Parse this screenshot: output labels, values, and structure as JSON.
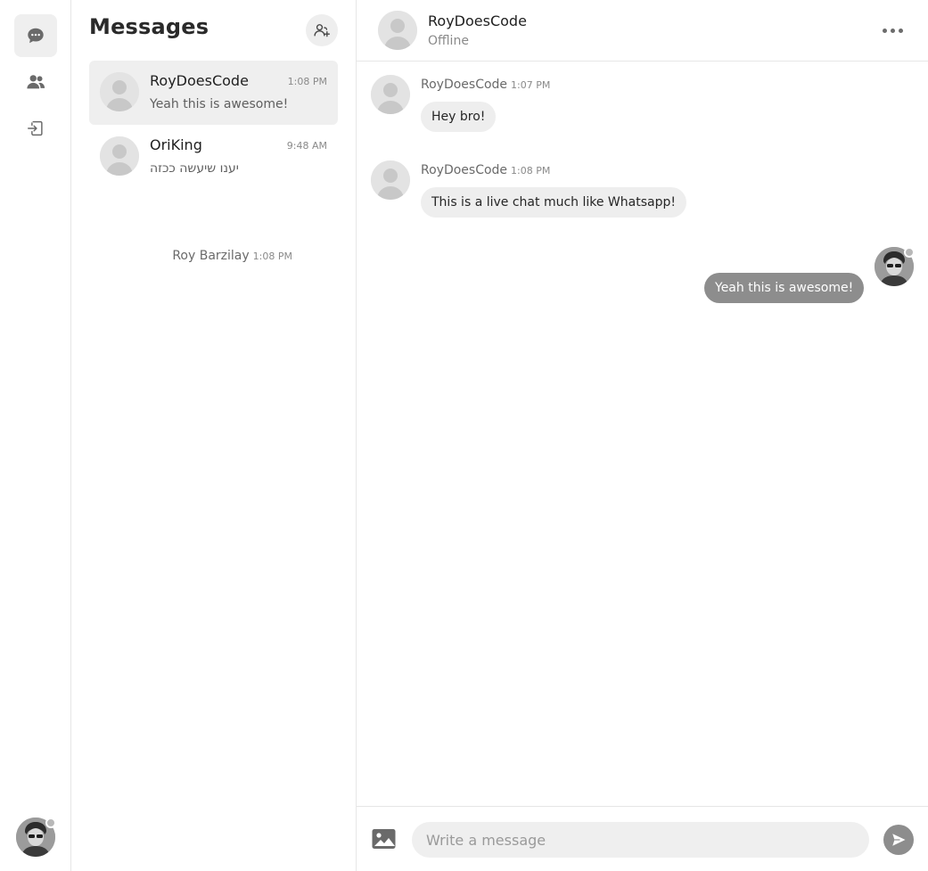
{
  "rail": {
    "items": [
      {
        "icon": "chat-bubble-icon",
        "active": true
      },
      {
        "icon": "users-icon",
        "active": false
      },
      {
        "icon": "logout-icon",
        "active": false
      }
    ],
    "me": {
      "presence": "offline"
    }
  },
  "list": {
    "title": "Messages",
    "conversations": [
      {
        "name": "RoyDoesCode",
        "time": "1:08 PM",
        "last": "Yeah this is awesome!",
        "active": true
      },
      {
        "name": "OriKing",
        "time": "9:48 AM",
        "last": "יענו שיעשה ככזה",
        "active": false
      }
    ]
  },
  "chat": {
    "header": {
      "name": "RoyDoesCode",
      "status": "Offline"
    },
    "messages": [
      {
        "sender": "RoyDoesCode",
        "time": "1:07 PM",
        "text": "Hey bro!",
        "mine": false
      },
      {
        "sender": "RoyDoesCode",
        "time": "1:08 PM",
        "text": "This is a live chat much like Whatsapp!",
        "mine": false
      },
      {
        "sender": "Roy Barzilay",
        "time": "1:08 PM",
        "text": "Yeah this is awesome!",
        "mine": true
      }
    ],
    "composer": {
      "placeholder": "Write a message"
    }
  },
  "colors": {
    "accent_gray": "#8d8d8d",
    "bubble_gray": "#eeeeee",
    "active_item": "#efefef"
  }
}
